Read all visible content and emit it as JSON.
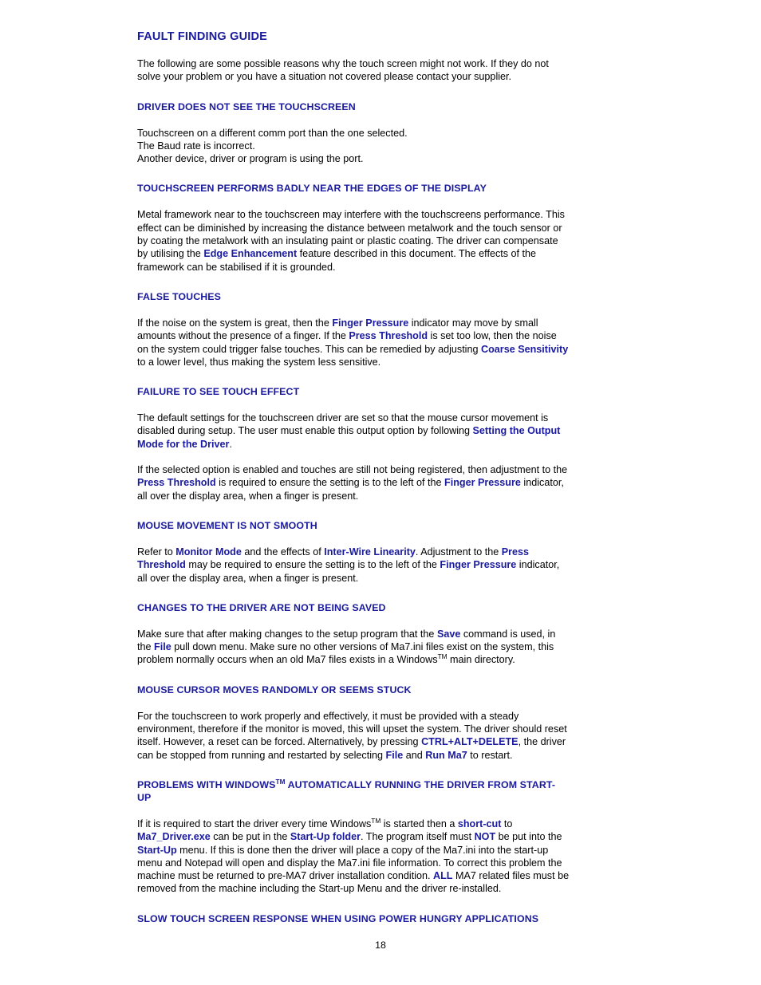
{
  "document": {
    "title": "FAULT FINDING GUIDE",
    "page_number": "18",
    "accent_color": "#1a1a9e",
    "body_color": "#000000",
    "background_color": "#ffffff"
  },
  "intro": {
    "text_1": "The following are some possible reasons why the touch screen might not work. If they do not",
    "text_2": "solve your problem or you have a situation not covered please contact your supplier."
  },
  "sections": [
    {
      "heading": "DRIVER DOES NOT SEE THE TOUCHSCREEN",
      "lines": [
        "Touchscreen on a different comm port than the one selected.",
        "The Baud rate is incorrect.",
        "Another device, driver or program is using the port."
      ]
    },
    {
      "heading": "TOUCHSCREEN PERFORMS BADLY NEAR THE EDGES OF THE DISPLAY",
      "para_a_1": "Metal framework near to the touchscreen may interfere with the touchscreens performance. This",
      "para_a_2": "effect can be diminished by increasing the distance between metalwork and the touch sensor or",
      "para_a_3": "by coating the metalwork with an insulating paint or plastic coating. The driver can compensate",
      "para_a_4a": "by utilising the ",
      "term_edge_enhancement": "Edge Enhancement",
      "para_a_4b": " feature described in this document. The effects of the",
      "para_a_5": "framework can be stabilised if it is grounded."
    },
    {
      "heading": "FALSE TOUCHES",
      "p1a": "If the noise on the system is great, then the ",
      "term_finger_pressure": "Finger Pressure",
      "p1b": " indicator may move by small",
      "p2a": "amounts without the presence of a finger. If the ",
      "term_press_threshold": "Press Threshold",
      "p2b": " is set too low, then the noise",
      "p3a": "on the system could trigger false touches. This can be remedied by adjusting ",
      "term_coarse_sensitivity": "Coarse Sensitivity",
      "p4": "to a lower level, thus making the system less sensitive."
    },
    {
      "heading": "FAILURE TO SEE TOUCH EFFECT",
      "p1_1": "The default settings for the touchscreen driver are set so that the mouse cursor movement is",
      "p1_2a": "disabled during setup. The user must enable this output option by following ",
      "term_setting_output": "Setting the Output",
      "p1_3a": "Mode for the Driver",
      "p1_3b": ".",
      "p2_1": "If the selected option is enabled and touches are still not being registered, then adjustment to the",
      "p2_2a": "Press Threshold",
      "p2_2b": " is required to ensure the setting is to the left of the ",
      "p2_2c": "Finger Pressure",
      "p2_2d": " indicator,",
      "p2_3": "all over the display area, when a finger is present."
    },
    {
      "heading": "MOUSE MOVEMENT IS NOT SMOOTH",
      "p1a": "Refer to ",
      "term_monitor_mode": "Monitor Mode",
      "p1b": " and the effects of ",
      "term_inter_wire": "Inter-Wire Linearity",
      "p1c": ". Adjustment to the ",
      "term_press": "Press",
      "p2a": "Threshold",
      "p2b": " may be required to ensure the setting is to the left of the ",
      "term_finger_pressure_2": "Finger Pressure",
      "p2c": " indicator,",
      "p3": "all over the display area, when a finger is present."
    },
    {
      "heading": "CHANGES TO THE DRIVER ARE NOT BEING SAVED",
      "p1a": "Make sure that after making changes to the setup program that the ",
      "term_save": "Save",
      "p1b": " command is used, in",
      "p2a": "the ",
      "term_file": "File",
      "p2b": " pull down menu. Make sure no other versions of Ma7.ini files exist on the system, this",
      "p3a": "problem normally occurs when an old Ma7 files exists in a Windows",
      "p3b": " main directory."
    },
    {
      "heading": "MOUSE CURSOR MOVES RANDOMLY OR SEEMS STUCK",
      "p1": "For the touchscreen to work properly and effectively, it must be provided with a steady",
      "p2": "environment, therefore if the monitor is moved, this will upset the system. The driver should reset",
      "p3a": "itself. However, a reset can be forced. Alternatively, by pressing ",
      "term_ctrl_alt_delete": "CTRL+ALT+DELETE",
      "p3b": ", the driver",
      "p4a": "can be stopped from running and restarted by selecting ",
      "term_file_2": "File",
      "p4b": " and ",
      "term_run_ma7": "Run Ma7",
      "p4c": " to restart."
    },
    {
      "heading_line_1": "PROBLEMS WITH WINDOWS",
      "heading_line_1b": " AUTOMATICALLY RUNNING THE DRIVER FROM START-",
      "heading_line_2": "UP",
      "p1a": "If it is required to start the driver every time Windows",
      "p1b": " is started then a ",
      "term_short_cut": "short-cut",
      "p1c": " to",
      "p2a": "Ma7_Driver.exe",
      "p2b": " can be put in the ",
      "term_startup_folder": "Start-Up folder",
      "p2c": ". The program itself must ",
      "term_not": "NOT",
      "p2d": " be put into the",
      "p3a": "Start-Up",
      "p3b": " menu. If this is done then the driver will place a copy of the Ma7.ini into the start-up",
      "p4": "menu and Notepad will open and display the Ma7.ini file information. To correct this problem the",
      "p5a": "machine must be returned to pre-MA7 driver installation condition. ",
      "term_all": "ALL",
      "p5b": " MA7 related files must be",
      "p6": "removed from the machine including the Start-up Menu and the driver re-installed."
    },
    {
      "heading": "SLOW TOUCH SCREEN RESPONSE WHEN USING POWER HUNGRY APPLICATIONS"
    }
  ]
}
